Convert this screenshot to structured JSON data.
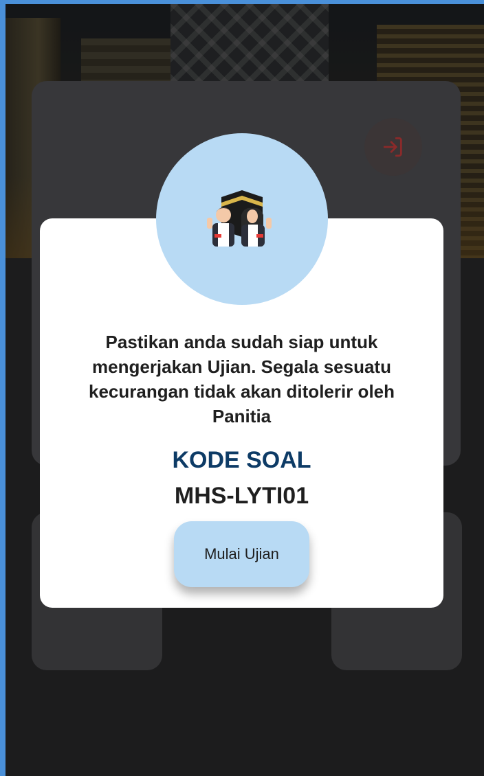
{
  "modal": {
    "message": "Pastikan anda sudah siap untuk mengerjakan Ujian. Segala sesuatu kecurangan tidak akan ditolerir oleh Panitia",
    "code_label": "KODE SOAL",
    "code_value": "MHS-LYTI01",
    "start_button": "Mulai Ujian",
    "illustration": "hajj-pilgrims-kaaba-illustration"
  },
  "icons": {
    "logout": "logout-icon"
  },
  "colors": {
    "accent_light_blue": "#b8daf4",
    "code_label": "#0d3b66",
    "logout_icon": "#8b2a2a",
    "frame_border": "#4a90d9"
  }
}
